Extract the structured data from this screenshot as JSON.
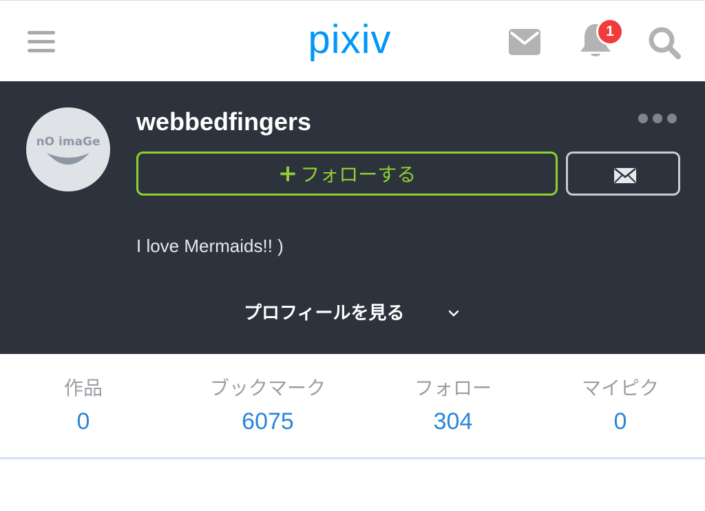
{
  "app": {
    "logo": "pixiv",
    "accent_color": "#0096fa",
    "follow_color": "#8fd032",
    "notification_badge_color": "#f03c3c"
  },
  "topbar": {
    "icons": [
      "menu-icon",
      "mail-icon",
      "bell-icon",
      "search-icon"
    ],
    "notification_count": "1"
  },
  "profile": {
    "avatar_text": "nO imaGe",
    "username": "webbedfingers",
    "follow_label": "フォローする",
    "follow_plus": "+",
    "bio": "I love Mermaids!! )",
    "view_profile_label": "プロフィールを見る"
  },
  "stats": [
    {
      "label": "作品",
      "value": "0"
    },
    {
      "label": "ブックマーク",
      "value": "6075"
    },
    {
      "label": "フォロー",
      "value": "304"
    },
    {
      "label": "マイピク",
      "value": "0"
    }
  ]
}
